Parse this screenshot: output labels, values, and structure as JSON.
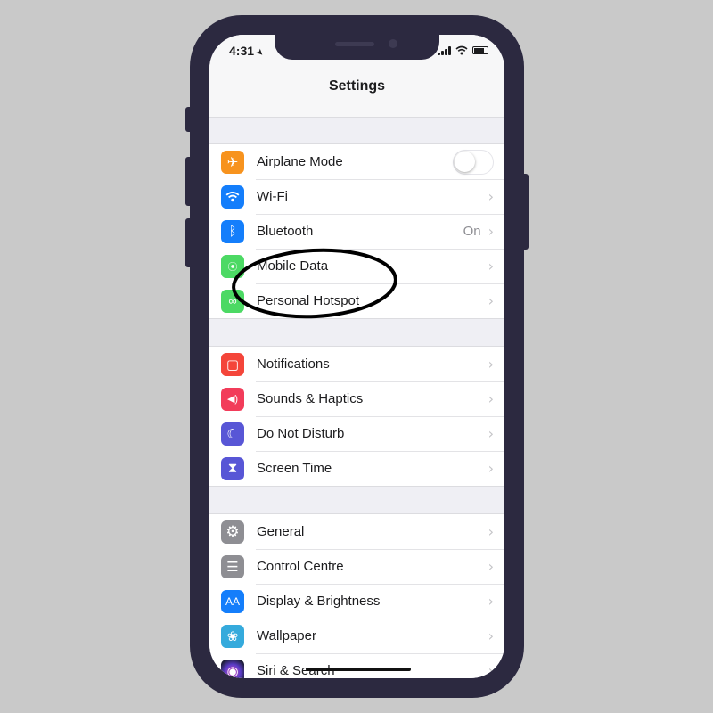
{
  "status_bar": {
    "time": "4:31",
    "location_icon": "location-arrow-icon",
    "icons": [
      "cellular-signal-icon",
      "wifi-icon",
      "battery-icon"
    ]
  },
  "nav": {
    "title": "Settings"
  },
  "groups": [
    {
      "items": [
        {
          "label": "Airplane Mode",
          "icon": "airplane-icon",
          "color": "#f7931e",
          "control": "toggle",
          "toggle_on": false
        },
        {
          "label": "Wi-Fi",
          "icon": "wifi-icon",
          "color": "#147efb",
          "control": "chevron"
        },
        {
          "label": "Bluetooth",
          "icon": "bluetooth-icon",
          "color": "#147efb",
          "value": "On",
          "control": "chevron"
        },
        {
          "label": "Mobile Data",
          "icon": "antenna-icon",
          "color": "#4cd964",
          "control": "chevron"
        },
        {
          "label": "Personal Hotspot",
          "icon": "hotspot-icon",
          "color": "#4cd964",
          "control": "chevron"
        }
      ]
    },
    {
      "items": [
        {
          "label": "Notifications",
          "icon": "notifications-icon",
          "color": "#f4453a",
          "control": "chevron"
        },
        {
          "label": "Sounds & Haptics",
          "icon": "speaker-icon",
          "color": "#f23c5a",
          "control": "chevron"
        },
        {
          "label": "Do Not Disturb",
          "icon": "moon-icon",
          "color": "#5856d6",
          "control": "chevron"
        },
        {
          "label": "Screen Time",
          "icon": "hourglass-icon",
          "color": "#5856d6",
          "control": "chevron"
        }
      ]
    },
    {
      "items": [
        {
          "label": "General",
          "icon": "gear-icon",
          "color": "#8e8e93",
          "control": "chevron"
        },
        {
          "label": "Control Centre",
          "icon": "toggles-icon",
          "color": "#8e8e93",
          "control": "chevron"
        },
        {
          "label": "Display & Brightness",
          "icon": "text-size-icon",
          "color": "#147efb",
          "control": "chevron"
        },
        {
          "label": "Wallpaper",
          "icon": "flower-icon",
          "color": "#35aadc",
          "control": "chevron"
        },
        {
          "label": "Siri & Search",
          "icon": "siri-icon",
          "color": "#1f1f3a",
          "control": "chevron"
        }
      ]
    }
  ],
  "glyphs": {
    "airplane": "✈",
    "wifi": "◠",
    "bluetooth": "ᛒ",
    "antenna": "⦿",
    "hotspot": "∞",
    "notifications": "▢",
    "speaker": "◀)",
    "moon": "☾",
    "hourglass": "⧗",
    "gear": "⚙",
    "toggles": "☰",
    "text_size": "AA",
    "flower": "❀",
    "siri": "◉",
    "chevron": "›"
  },
  "annotation": {
    "type": "hand-drawn-circle",
    "target": "Personal Hotspot",
    "color": "#000000"
  }
}
